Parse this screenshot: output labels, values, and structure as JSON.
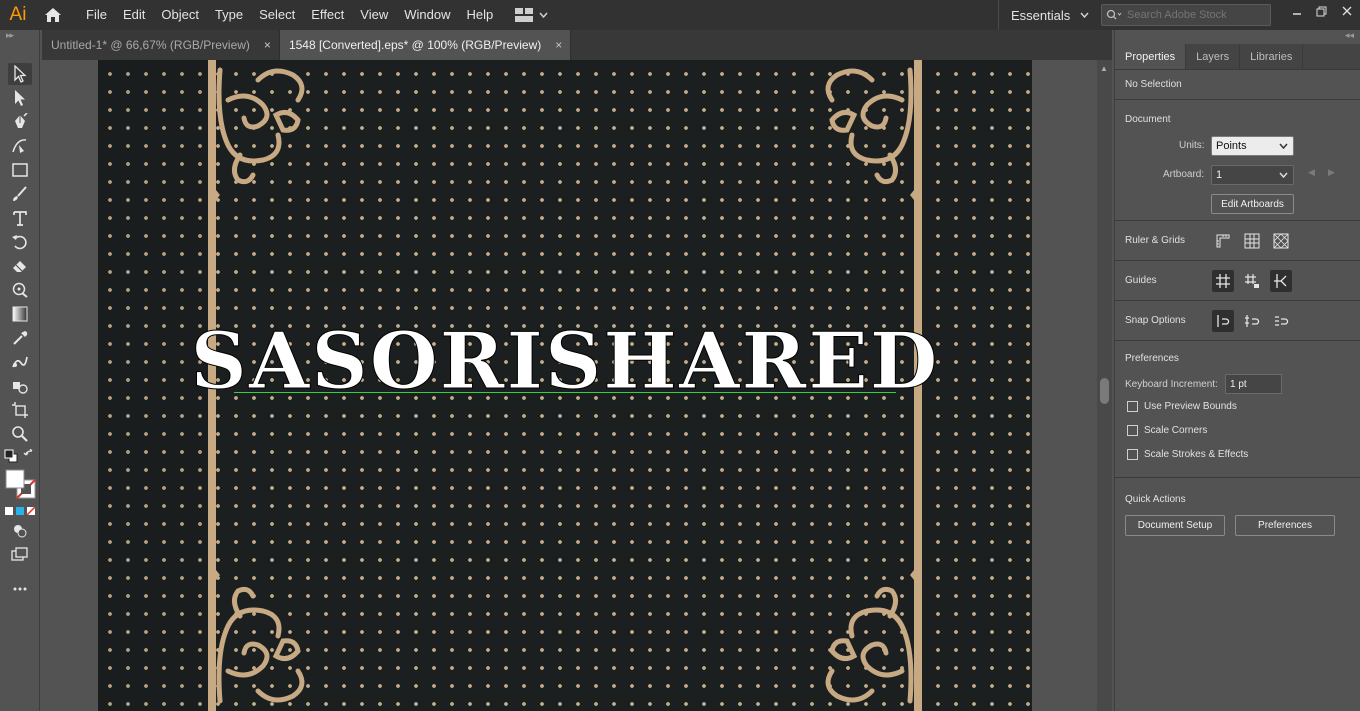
{
  "app": {
    "logo_text": "Ai"
  },
  "menubar": {
    "items": [
      "File",
      "Edit",
      "Object",
      "Type",
      "Select",
      "Effect",
      "View",
      "Window",
      "Help"
    ],
    "workspace": "Essentials",
    "search_placeholder": "Search Adobe Stock"
  },
  "tabs": [
    {
      "label": "Untitled-1* @ 66,67% (RGB/Preview)",
      "close": "×"
    },
    {
      "label": "1548 [Converted].eps* @ 100% (RGB/Preview)",
      "close": "×"
    }
  ],
  "canvas": {
    "headline": "SASORISHARED"
  },
  "colors": {
    "dots": "#c5ad8a",
    "artboard_bg": "#1c1f20",
    "ornament": "#c7a983",
    "selection": "#2fd23f",
    "logo": "#ff9a00"
  },
  "panel": {
    "tabs": [
      "Properties",
      "Layers",
      "Libraries"
    ],
    "selection_state": "No Selection",
    "document": {
      "title": "Document",
      "units_label": "Units:",
      "units_value": "Points",
      "artboard_label": "Artboard:",
      "artboard_value": "1",
      "edit_artboards": "Edit Artboards"
    },
    "ruler_grids": {
      "title": "Ruler & Grids"
    },
    "guides": {
      "title": "Guides"
    },
    "snap": {
      "title": "Snap Options"
    },
    "preferences": {
      "title": "Preferences",
      "keyboard_increment_label": "Keyboard Increment:",
      "keyboard_increment_value": "1 pt",
      "checkboxes": [
        "Use Preview Bounds",
        "Scale Corners",
        "Scale Strokes & Effects"
      ]
    },
    "quick_actions": {
      "title": "Quick Actions",
      "document_setup": "Document Setup",
      "preferences_btn": "Preferences"
    }
  }
}
